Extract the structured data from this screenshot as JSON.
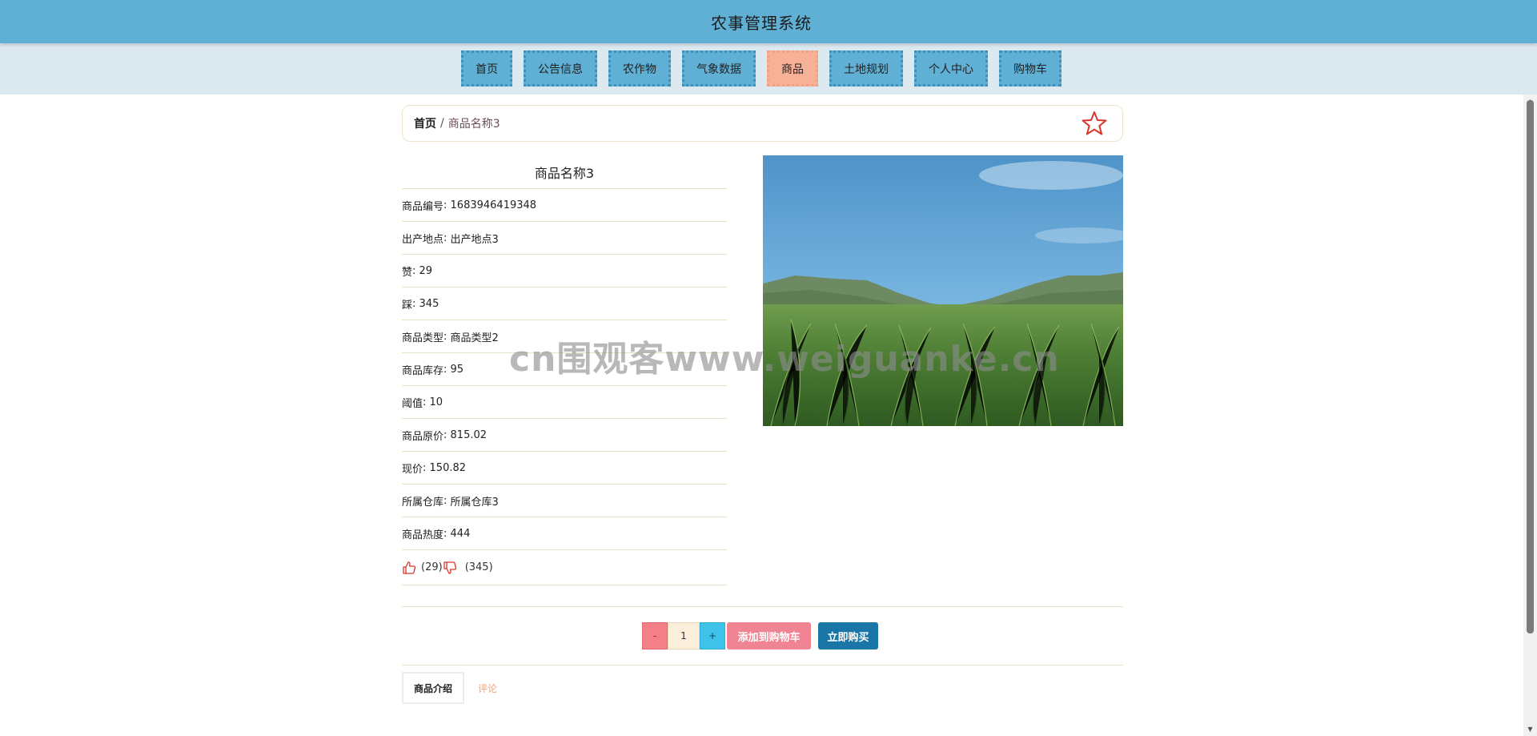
{
  "app": {
    "title": "农事管理系统"
  },
  "nav": {
    "items": [
      {
        "label": "首页"
      },
      {
        "label": "公告信息"
      },
      {
        "label": "农作物"
      },
      {
        "label": "气象数据"
      },
      {
        "label": "商品",
        "active": true
      },
      {
        "label": "土地规划"
      },
      {
        "label": "个人中心"
      },
      {
        "label": "购物车"
      }
    ]
  },
  "breadcrumb": {
    "home": "首页",
    "separator": "/",
    "current": "商品名称3"
  },
  "product": {
    "name": "商品名称3",
    "rows": [
      {
        "key": "商品编号",
        "value": "1683946419348"
      },
      {
        "key": "出产地点",
        "value": "出产地点3"
      },
      {
        "key": "赞",
        "value": "29"
      },
      {
        "key": "踩",
        "value": "345"
      },
      {
        "key": "商品类型",
        "value": "商品类型2"
      },
      {
        "key": "商品库存",
        "value": "95"
      },
      {
        "key": "阈值",
        "value": "10"
      },
      {
        "key": "商品原价",
        "value": "815.02"
      },
      {
        "key": "现价",
        "value": "150.82"
      },
      {
        "key": "所属仓库",
        "value": "所属仓库3"
      },
      {
        "key": "商品热度",
        "value": "444"
      }
    ],
    "likes": "(29)",
    "dislikes": "(345)",
    "image_desc": "cornfield with mountains under blue sky"
  },
  "watermark": "cn围观客www.weiguanke.cn",
  "purchase": {
    "minus": "-",
    "quantity": "1",
    "plus": "+",
    "add_to_cart": "添加到购物车",
    "buy_now": "立即购买"
  },
  "tabs": [
    {
      "label": "商品介绍",
      "active": true
    },
    {
      "label": "评论"
    }
  ],
  "icons": {
    "favorite": "star-icon",
    "like": "thumbs-up-icon",
    "dislike": "thumbs-down-icon"
  },
  "colors": {
    "header": "#5fb0d4",
    "nav_bg": "#dde9f1",
    "nav_active": "#f8b196",
    "accent_red": "#d9362b",
    "cart_button": "#f08493",
    "buy_button": "#1b76a8"
  }
}
